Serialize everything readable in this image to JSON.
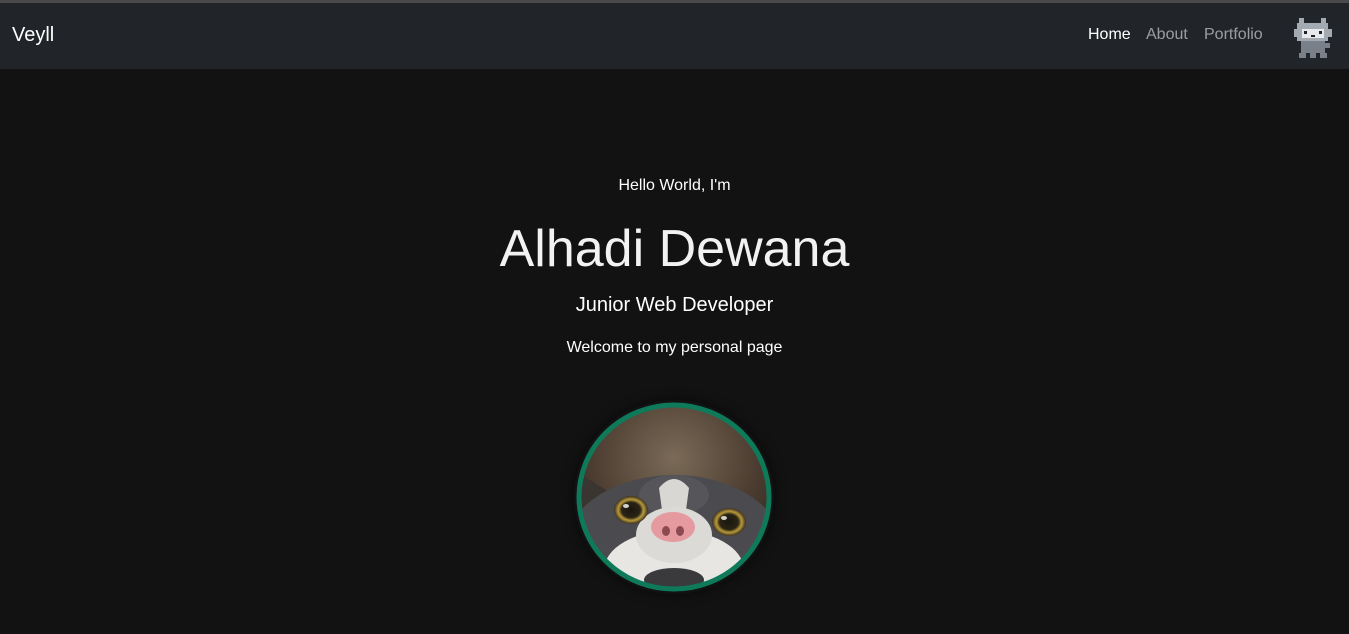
{
  "navbar": {
    "brand": "Veyll",
    "links": [
      {
        "label": "Home",
        "active": true
      },
      {
        "label": "About",
        "active": false
      },
      {
        "label": "Portfolio",
        "active": false
      }
    ],
    "mascot_icon": "pixel-cat-icon"
  },
  "hero": {
    "greeting": "Hello World, I'm",
    "name": "Alhadi Dewana",
    "role": "Junior Web Developer",
    "welcome": "Welcome to my personal page",
    "avatar_icon": "cat-photo-avatar",
    "avatar_border_color": "#0f7a5a"
  },
  "colors": {
    "background": "#121212",
    "navbar": "#212529",
    "accent": "#0f7a5a"
  }
}
